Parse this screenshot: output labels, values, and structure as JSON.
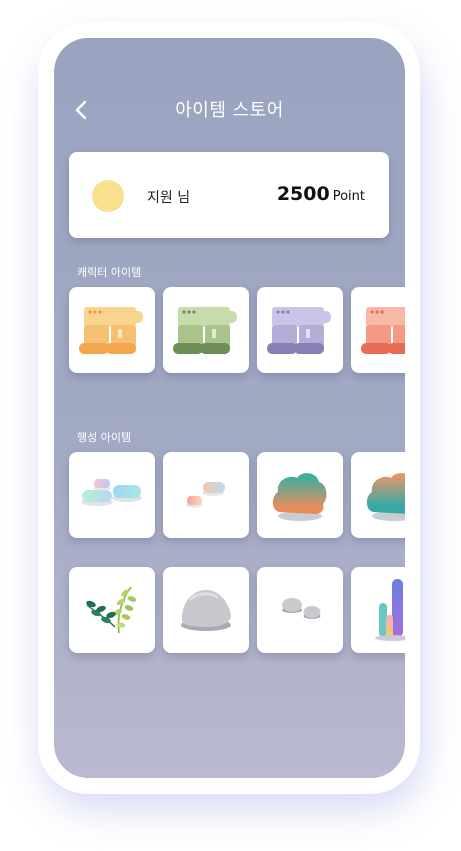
{
  "header": {
    "title": "아이템 스토어"
  },
  "user": {
    "name": "지원 님",
    "points": "2500",
    "points_unit": "Point"
  },
  "sections": {
    "character": {
      "title": "캐릭터 아이템"
    },
    "planet": {
      "title": "행성 아이템"
    }
  },
  "colors": {
    "background": "#9aa4c0",
    "avatar": "#f9e08f",
    "boots_orange": "#f4c071",
    "boots_green": "#a9c48a",
    "boots_purple": "#b3aed8",
    "boots_coral": "#f39a85"
  },
  "items": {
    "character": [
      "orange-boots-icon",
      "green-boots-icon",
      "purple-boots-icon",
      "coral-boots-icon"
    ],
    "planet_row1": [
      "cloud-platforms-icon",
      "small-cloud-icon",
      "teal-orange-bush-icon",
      "teal-bush-icon"
    ],
    "planet_row2": [
      "fern-plant-icon",
      "rock-icon",
      "pebbles-icon",
      "crystal-plant-icon"
    ]
  }
}
